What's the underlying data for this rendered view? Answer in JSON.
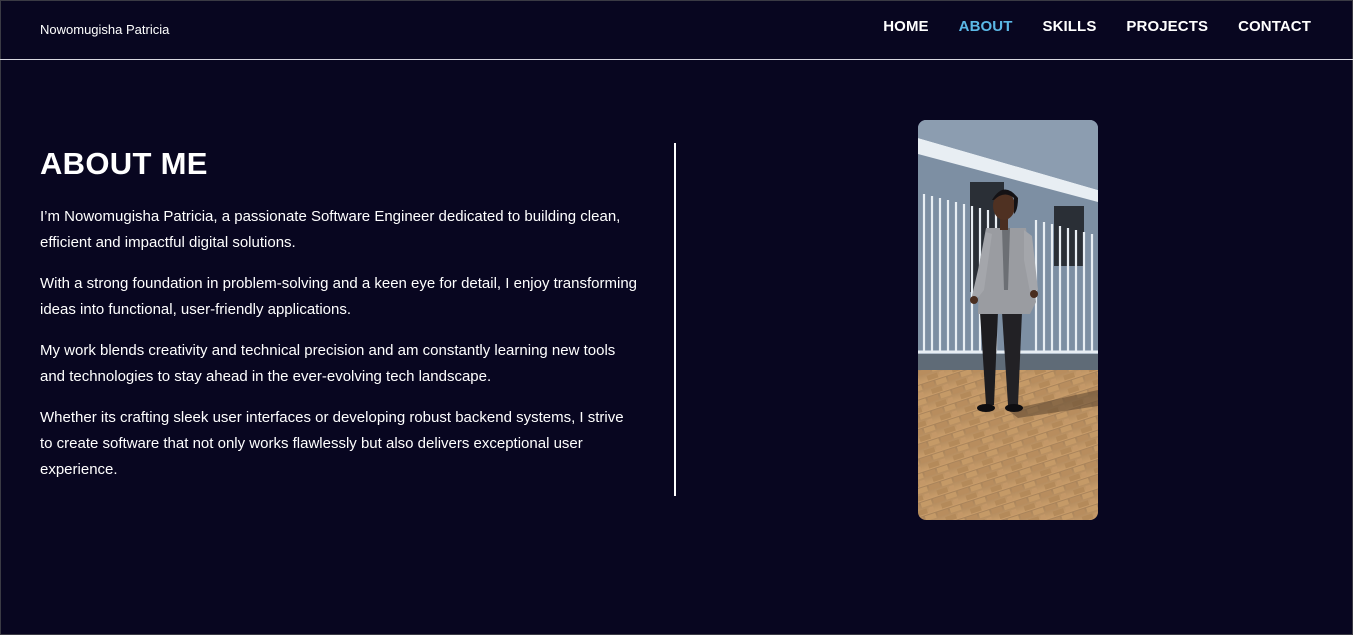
{
  "header": {
    "brand": "Nowomugisha Patricia",
    "nav": [
      {
        "label": "HOME",
        "active": false
      },
      {
        "label": "ABOUT",
        "active": true
      },
      {
        "label": "SKILLS",
        "active": false
      },
      {
        "label": "PROJECTS",
        "active": false
      },
      {
        "label": "CONTACT",
        "active": false
      }
    ]
  },
  "about": {
    "title": "ABOUT ME",
    "paragraphs": [
      "I’m Nowomugisha Patricia, a passionate Software Engineer dedicated to building clean, efficient and impactful digital solutions.",
      "With a strong foundation in problem-solving and a keen eye for detail, I enjoy transforming ideas into functional, user-friendly applications.",
      "My work blends creativity and technical precision and am constantly learning new tools and technologies to stay ahead in the ever-evolving tech landscape.",
      "Whether its crafting sleek user interfaces or developing robust backend systems, I strive to create software that not only works flawlessly but also delivers exceptional user experience."
    ]
  },
  "colors": {
    "background": "#080620",
    "accent": "#5bb8e6",
    "text": "#ffffff"
  }
}
